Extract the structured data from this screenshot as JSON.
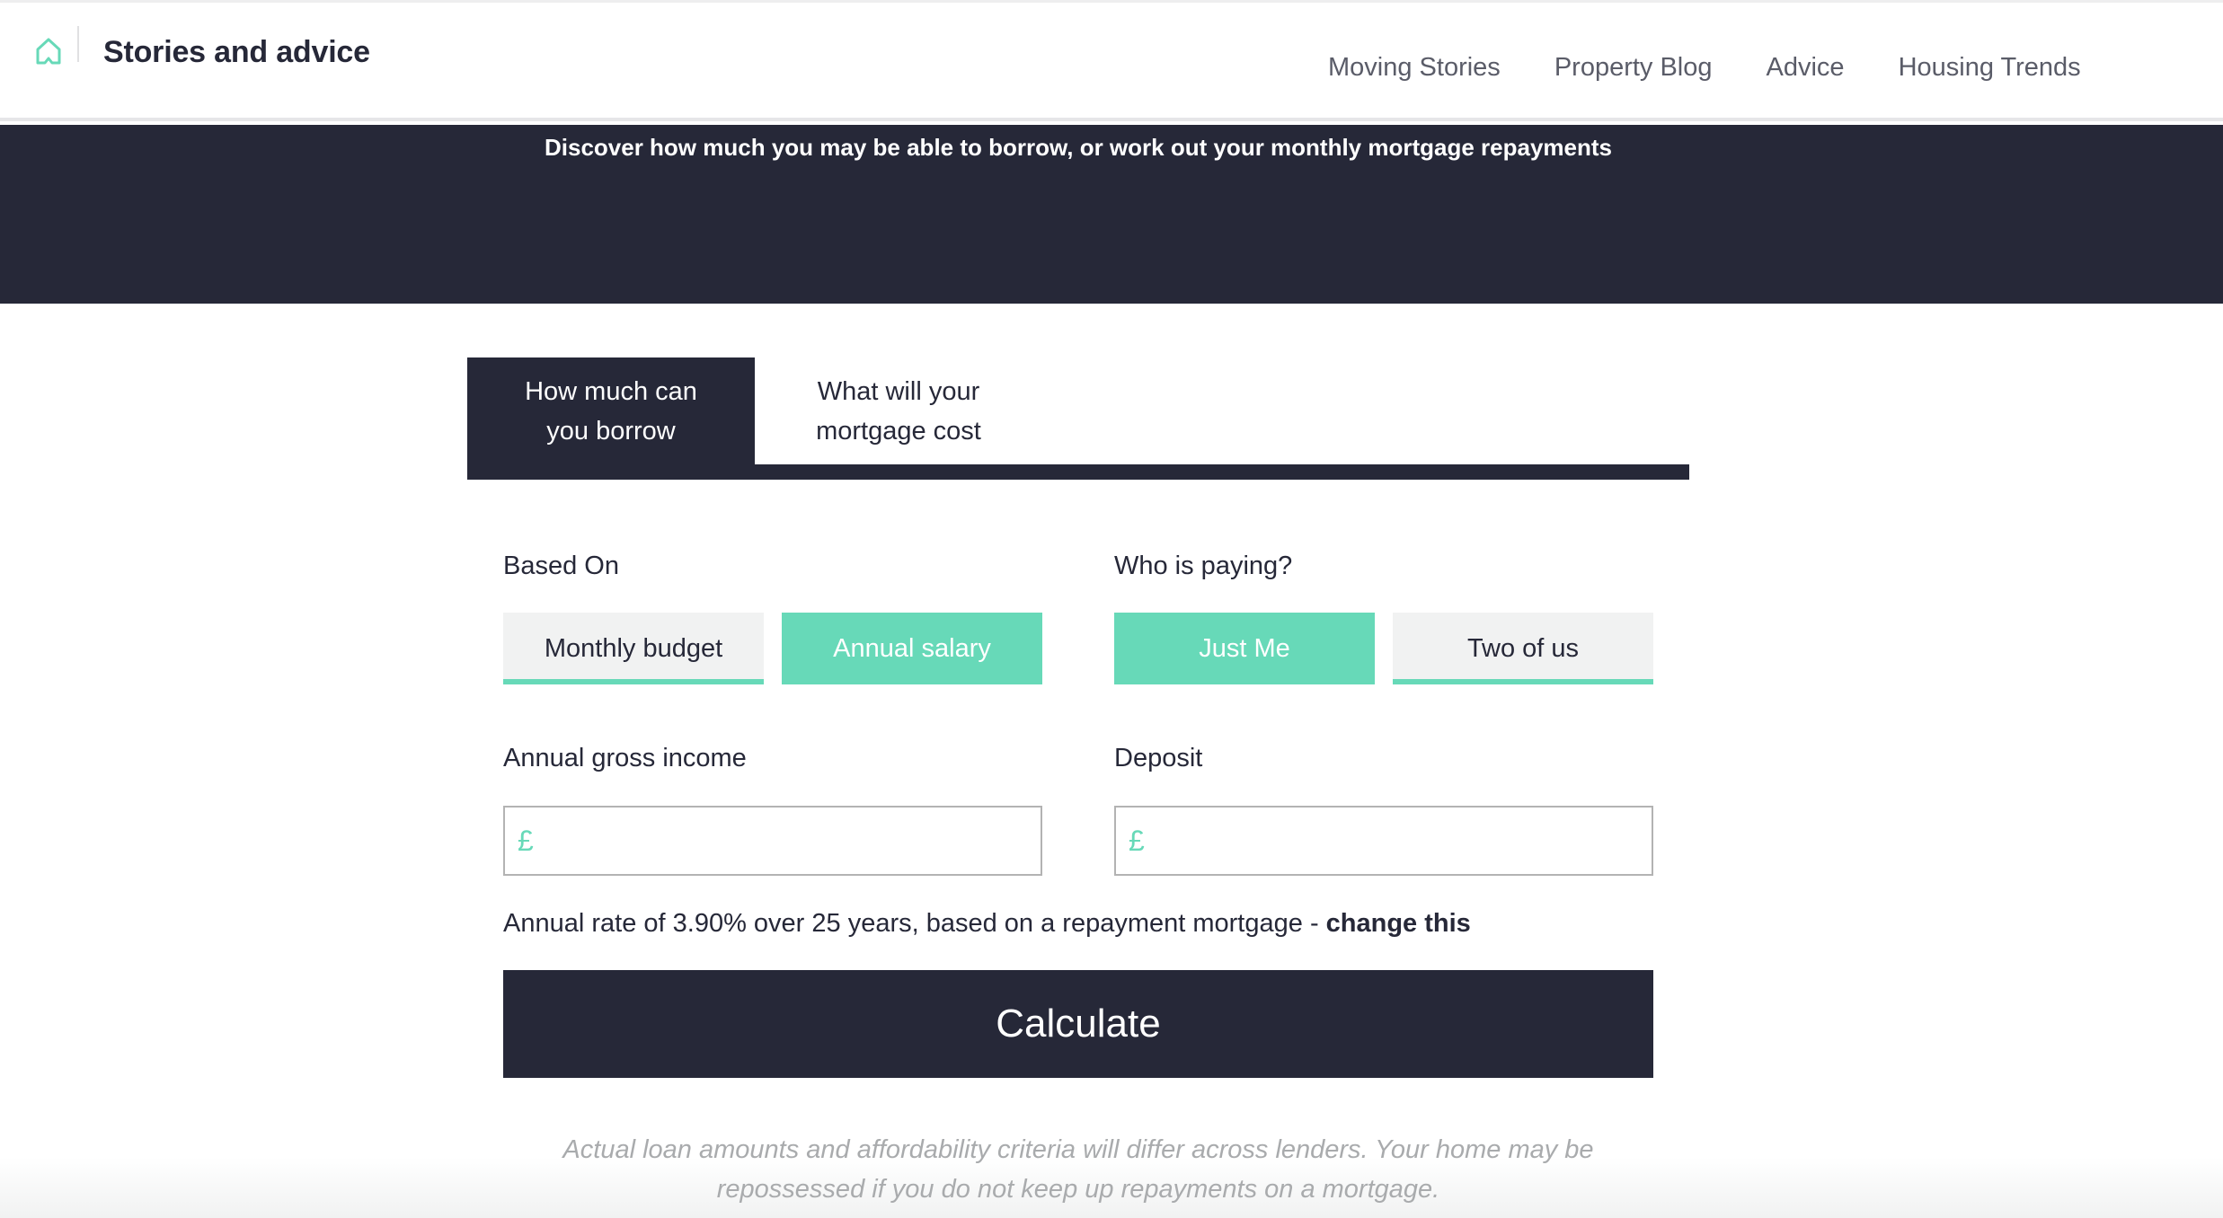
{
  "header": {
    "logo_icon": "home-icon",
    "title": "Stories and advice",
    "nav": [
      {
        "label": "Moving Stories"
      },
      {
        "label": "Property Blog"
      },
      {
        "label": "Advice"
      },
      {
        "label": "Housing Trends"
      }
    ]
  },
  "hero": {
    "subtitle": "Discover how much you may be able to borrow, or work out your monthly mortgage repayments"
  },
  "tabs": [
    {
      "label": "How much can you borrow",
      "active": true
    },
    {
      "label": "What will your mortgage cost",
      "active": false
    }
  ],
  "form": {
    "based_on": {
      "label": "Based On",
      "options": [
        {
          "label": "Monthly budget",
          "selected": false
        },
        {
          "label": "Annual salary",
          "selected": true
        }
      ]
    },
    "who_is_paying": {
      "label": "Who is paying?",
      "options": [
        {
          "label": "Just Me",
          "selected": true
        },
        {
          "label": "Two of us",
          "selected": false
        }
      ]
    },
    "annual_income": {
      "label": "Annual gross income",
      "currency_symbol": "£",
      "value": ""
    },
    "deposit": {
      "label": "Deposit",
      "currency_symbol": "£",
      "value": ""
    },
    "rate_text": "Annual rate of 3.90% over 25 years, based on a repayment mortgage - ",
    "change_link": "change this",
    "calculate_label": "Calculate"
  },
  "disclaimer": "Actual loan amounts and affordability criteria will differ across lenders. Your home may be repossessed if you do not keep up repayments on a mortgage.",
  "colors": {
    "dark": "#262838",
    "accent": "#67d9b8",
    "nav_text": "#5a5c68"
  }
}
